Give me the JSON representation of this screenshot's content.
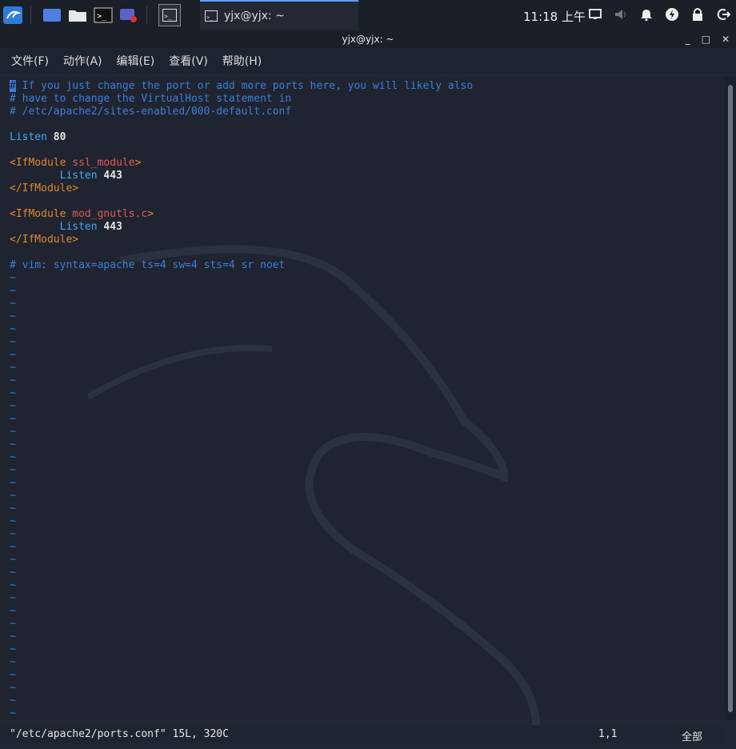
{
  "taskbar": {
    "window_title": "yjx@yjx: ~",
    "clock": "11:18 上午",
    "icons": [
      "kali-menu-icon",
      "desktop-icon",
      "folder-icon",
      "terminal-icon",
      "recorder-icon",
      "terminal-window-icon"
    ],
    "tray_icons": [
      "display-icon",
      "volume-icon",
      "bell-icon",
      "power-manager-icon",
      "lock-icon",
      "logout-icon"
    ]
  },
  "window": {
    "title": "yjx@yjx: ~",
    "controls": [
      "_",
      "□",
      "✕"
    ],
    "menu": [
      "文件(F)",
      "动作(A)",
      "编辑(E)",
      "查看(V)",
      "帮助(H)"
    ]
  },
  "editor": {
    "lines": [
      "# If you just change the port or add more ports here, you will likely also",
      "# have to change the VirtualHost statement in",
      "# /etc/apache2/sites-enabled/000-default.conf",
      "",
      "Listen 80",
      "",
      "<IfModule ssl_module>",
      "        Listen 443",
      "</IfModule>",
      "",
      "<IfModule mod_gnutls.c>",
      "        Listen 443",
      "</IfModule>",
      "",
      "# vim: syntax=apache ts=4 sw=4 sts=4 sr noet"
    ],
    "tilde_count": 35,
    "tilde_char": "~"
  },
  "status": {
    "file_info": "\"/etc/apache2/ports.conf\" 15L, 320C",
    "cursor_pos": "1,1",
    "scroll_pos": "全部"
  }
}
